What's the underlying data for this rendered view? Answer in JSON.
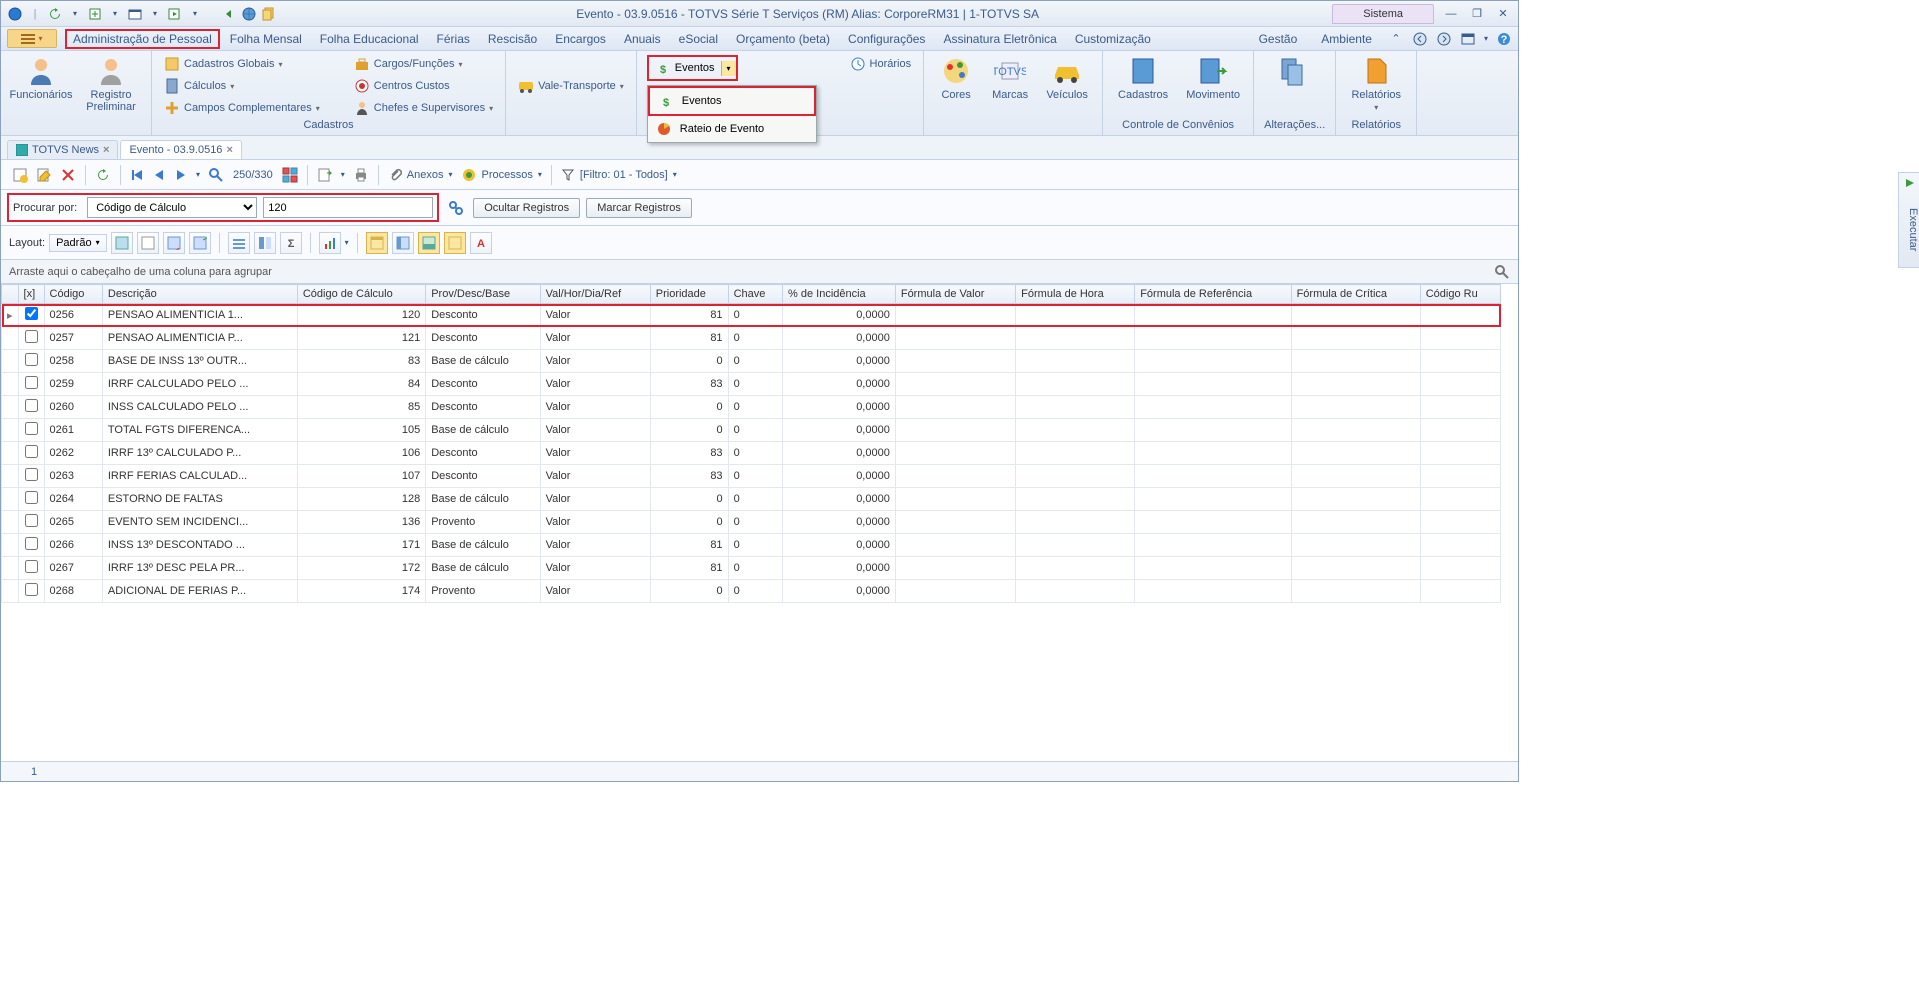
{
  "title": "Evento - 03.9.0516 - TOTVS Série T Serviços (RM) Alias: CorporeRM31 | 1-TOTVS SA",
  "system_tab": "Sistema",
  "menu": {
    "items": [
      "Administração de Pessoal",
      "Folha Mensal",
      "Folha Educacional",
      "Férias",
      "Rescisão",
      "Encargos",
      "Anuais",
      "eSocial",
      "Orçamento (beta)",
      "Configurações",
      "Assinatura Eletrônica",
      "Customização"
    ],
    "right": [
      "Gestão",
      "Ambiente"
    ]
  },
  "ribbon": {
    "g1": {
      "funcionarios": "Funcionários",
      "registro": "Registro Preliminar"
    },
    "g2": {
      "cadastros": "Cadastros Globais",
      "calculos": "Cálculos",
      "campos": "Campos Complementares",
      "cargos": "Cargos/Funções",
      "centros": "Centros Custos",
      "chefes": "Chefes e Supervisores",
      "label": "Cadastros"
    },
    "g3": {
      "vale": "Vale-Transporte"
    },
    "g4": {
      "eventos": "Eventos",
      "popup_eventos": "Eventos",
      "popup_rateio": "Rateio de Evento",
      "horarios": "Horários"
    },
    "g5": {
      "cores": "Cores",
      "marcas": "Marcas",
      "veiculos": "Veículos"
    },
    "g6": {
      "cadastros": "Cadastros",
      "movimento": "Movimento",
      "label": "Controle de Convênios"
    },
    "g7": {
      "label": "Alterações..."
    },
    "g8": {
      "relatorios": "Relatórios",
      "label": "Relatórios"
    }
  },
  "side_exec": "Executar",
  "tabs": [
    {
      "label": "TOTVS News"
    },
    {
      "label": "Evento - 03.9.0516"
    }
  ],
  "toolbar": {
    "counter": "250/330",
    "anexos": "Anexos",
    "processos": "Processos",
    "filtro": "[Filtro: 01 - Todos]"
  },
  "search": {
    "label": "Procurar por:",
    "field": "Código de Cálculo",
    "value": "120",
    "ocultar": "Ocultar Registros",
    "marcar": "Marcar Registros"
  },
  "layout": {
    "label": "Layout:",
    "padrao": "Padrão"
  },
  "groupbar": "Arraste aqui o cabeçalho de uma coluna para agrupar",
  "grid": {
    "headers": [
      "[x]",
      "Código",
      "Descrição",
      "Código de Cálculo",
      "Prov/Desc/Base",
      "Val/Hor/Dia/Ref",
      "Prioridade",
      "Chave",
      "% de Incidência",
      "Fórmula de Valor",
      "Fórmula de Hora",
      "Fórmula de Referência",
      "Fórmula de Crítica",
      "Código Ru"
    ],
    "rows": [
      {
        "chk": true,
        "codigo": "0256",
        "desc": "PENSAO ALIMENTICIA 1...",
        "cc": "120",
        "pdb": "Desconto",
        "vhd": "Valor",
        "prio": "81",
        "chave": "0",
        "inc": "0,0000",
        "hl": true
      },
      {
        "chk": false,
        "codigo": "0257",
        "desc": "PENSAO ALIMENTICIA P...",
        "cc": "121",
        "pdb": "Desconto",
        "vhd": "Valor",
        "prio": "81",
        "chave": "0",
        "inc": "0,0000"
      },
      {
        "chk": false,
        "codigo": "0258",
        "desc": "BASE DE INSS 13º OUTR...",
        "cc": "83",
        "pdb": "Base de cálculo",
        "vhd": "Valor",
        "prio": "0",
        "chave": "0",
        "inc": "0,0000"
      },
      {
        "chk": false,
        "codigo": "0259",
        "desc": "IRRF CALCULADO PELO ...",
        "cc": "84",
        "pdb": "Desconto",
        "vhd": "Valor",
        "prio": "83",
        "chave": "0",
        "inc": "0,0000"
      },
      {
        "chk": false,
        "codigo": "0260",
        "desc": "INSS CALCULADO PELO ...",
        "cc": "85",
        "pdb": "Desconto",
        "vhd": "Valor",
        "prio": "0",
        "chave": "0",
        "inc": "0,0000"
      },
      {
        "chk": false,
        "codigo": "0261",
        "desc": "TOTAL FGTS DIFERENCA...",
        "cc": "105",
        "pdb": "Base de cálculo",
        "vhd": "Valor",
        "prio": "0",
        "chave": "0",
        "inc": "0,0000"
      },
      {
        "chk": false,
        "codigo": "0262",
        "desc": "IRRF 13º CALCULADO P...",
        "cc": "106",
        "pdb": "Desconto",
        "vhd": "Valor",
        "prio": "83",
        "chave": "0",
        "inc": "0,0000"
      },
      {
        "chk": false,
        "codigo": "0263",
        "desc": "IRRF FERIAS CALCULAD...",
        "cc": "107",
        "pdb": "Desconto",
        "vhd": "Valor",
        "prio": "83",
        "chave": "0",
        "inc": "0,0000"
      },
      {
        "chk": false,
        "codigo": "0264",
        "desc": "ESTORNO DE FALTAS",
        "cc": "128",
        "pdb": "Base de cálculo",
        "vhd": "Valor",
        "prio": "0",
        "chave": "0",
        "inc": "0,0000"
      },
      {
        "chk": false,
        "codigo": "0265",
        "desc": "EVENTO SEM INCIDENCI...",
        "cc": "136",
        "pdb": "Provento",
        "vhd": "Valor",
        "prio": "0",
        "chave": "0",
        "inc": "0,0000"
      },
      {
        "chk": false,
        "codigo": "0266",
        "desc": "INSS 13º DESCONTADO ...",
        "cc": "171",
        "pdb": "Base de cálculo",
        "vhd": "Valor",
        "prio": "81",
        "chave": "0",
        "inc": "0,0000"
      },
      {
        "chk": false,
        "codigo": "0267",
        "desc": "IRRF 13º DESC PELA PR...",
        "cc": "172",
        "pdb": "Base de cálculo",
        "vhd": "Valor",
        "prio": "81",
        "chave": "0",
        "inc": "0,0000"
      },
      {
        "chk": false,
        "codigo": "0268",
        "desc": "ADICIONAL DE FERIAS P...",
        "cc": "174",
        "pdb": "Provento",
        "vhd": "Valor",
        "prio": "0",
        "chave": "0",
        "inc": "0,0000"
      }
    ]
  },
  "status": {
    "page": "1"
  }
}
